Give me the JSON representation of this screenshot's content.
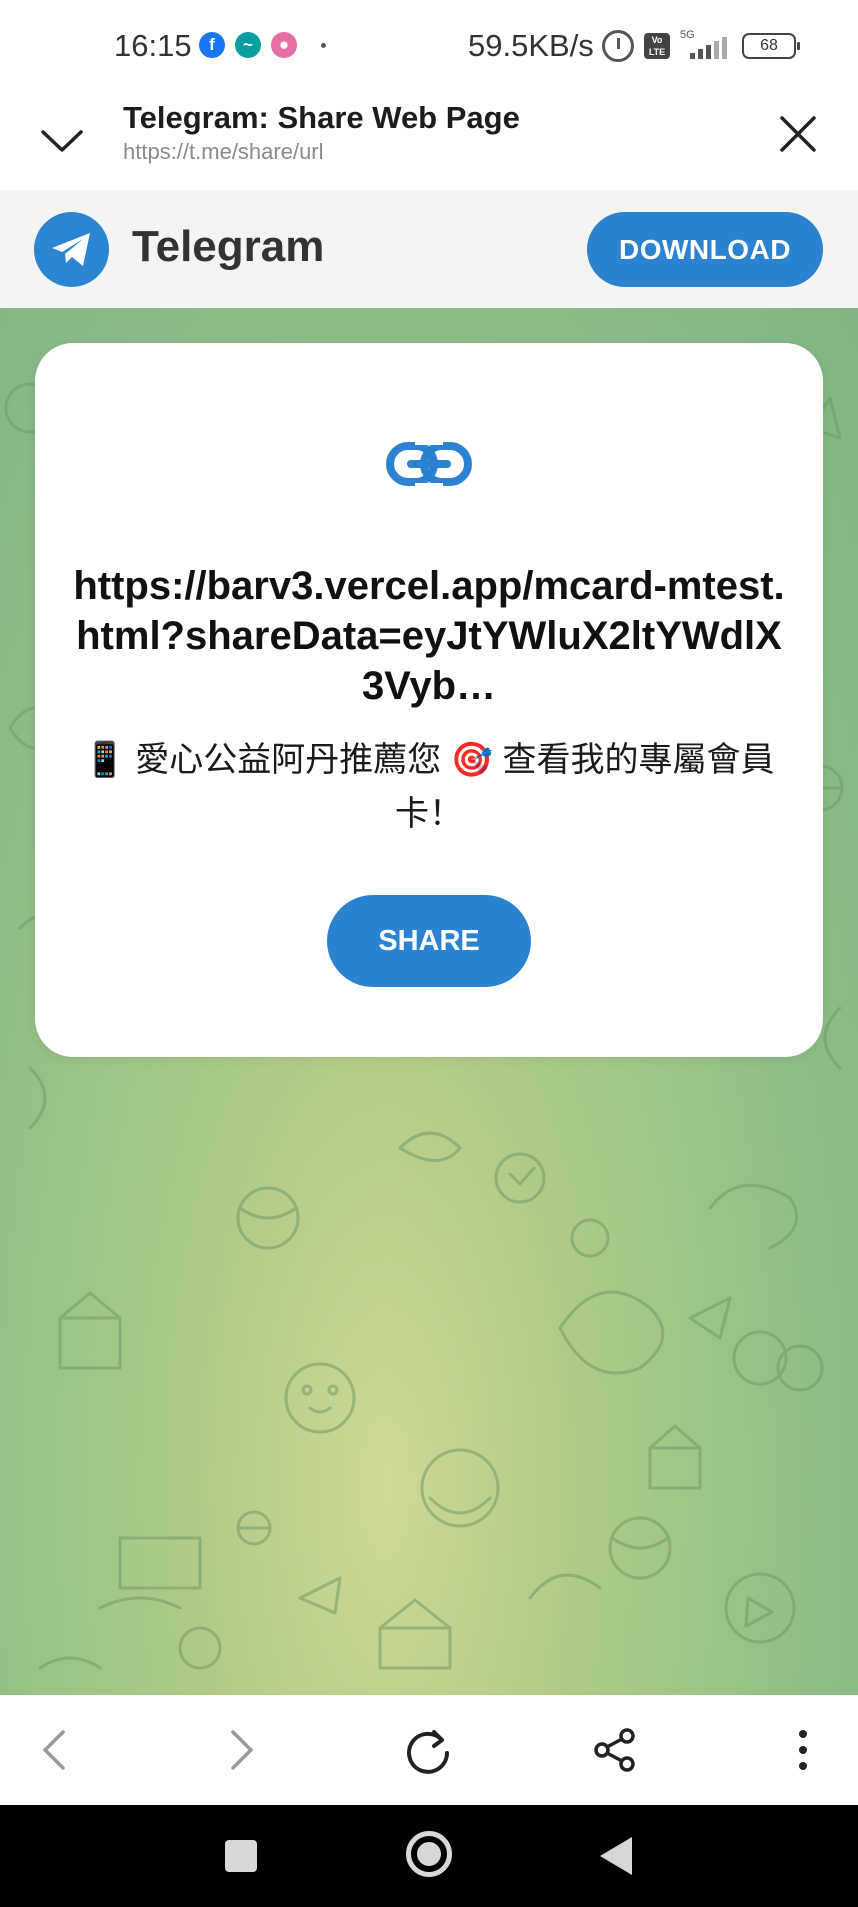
{
  "status_bar": {
    "time": "16:15",
    "network_speed": "59.5KB/s",
    "signal_type": "5G",
    "volte": "Vo LTE",
    "battery": "68",
    "app_icons": [
      "facebook-icon",
      "wave-app-icon",
      "pink-app-icon"
    ]
  },
  "browser": {
    "title": "Telegram: Share Web Page",
    "url": "https://t.me/share/url"
  },
  "telegram_banner": {
    "name": "Telegram",
    "download_label": "DOWNLOAD",
    "accent_color": "#2a82d0"
  },
  "share_card": {
    "url": "https://barv3.vercel.app/mcard-mtest.html?shareData=eyJtYWluX2ltYWdlX3Vyb…",
    "description": "📱 愛心公益阿丹推薦您 🎯 查看我的專屬會員卡！",
    "share_label": "SHARE"
  },
  "toolbar": {
    "items": [
      "back-icon",
      "forward-icon",
      "reload-icon",
      "share-icon",
      "more-icon"
    ]
  }
}
